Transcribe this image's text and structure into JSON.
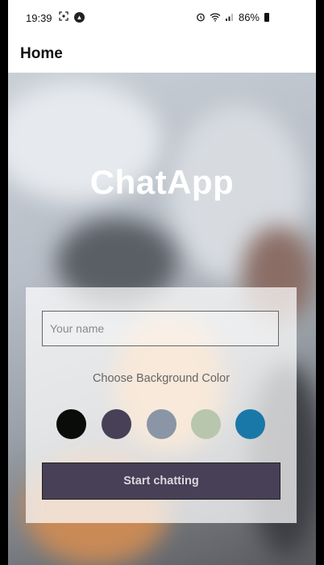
{
  "status_bar": {
    "time": "19:39",
    "battery": "86%",
    "icons": [
      "screenshot-icon",
      "app-notification-icon",
      "alarm-icon",
      "wifi-icon",
      "signal-icon",
      "battery-icon"
    ]
  },
  "app_bar": {
    "title": "Home"
  },
  "main": {
    "app_title": "ChatApp",
    "name_input": {
      "placeholder": "Your name",
      "value": ""
    },
    "choose_color_label": "Choose Background Color",
    "colors": [
      "#090C08",
      "#474056",
      "#8A95A5",
      "#B9C6AE",
      "#1A78A8"
    ],
    "start_button_label": "Start chatting",
    "start_button_color": "#474056"
  }
}
